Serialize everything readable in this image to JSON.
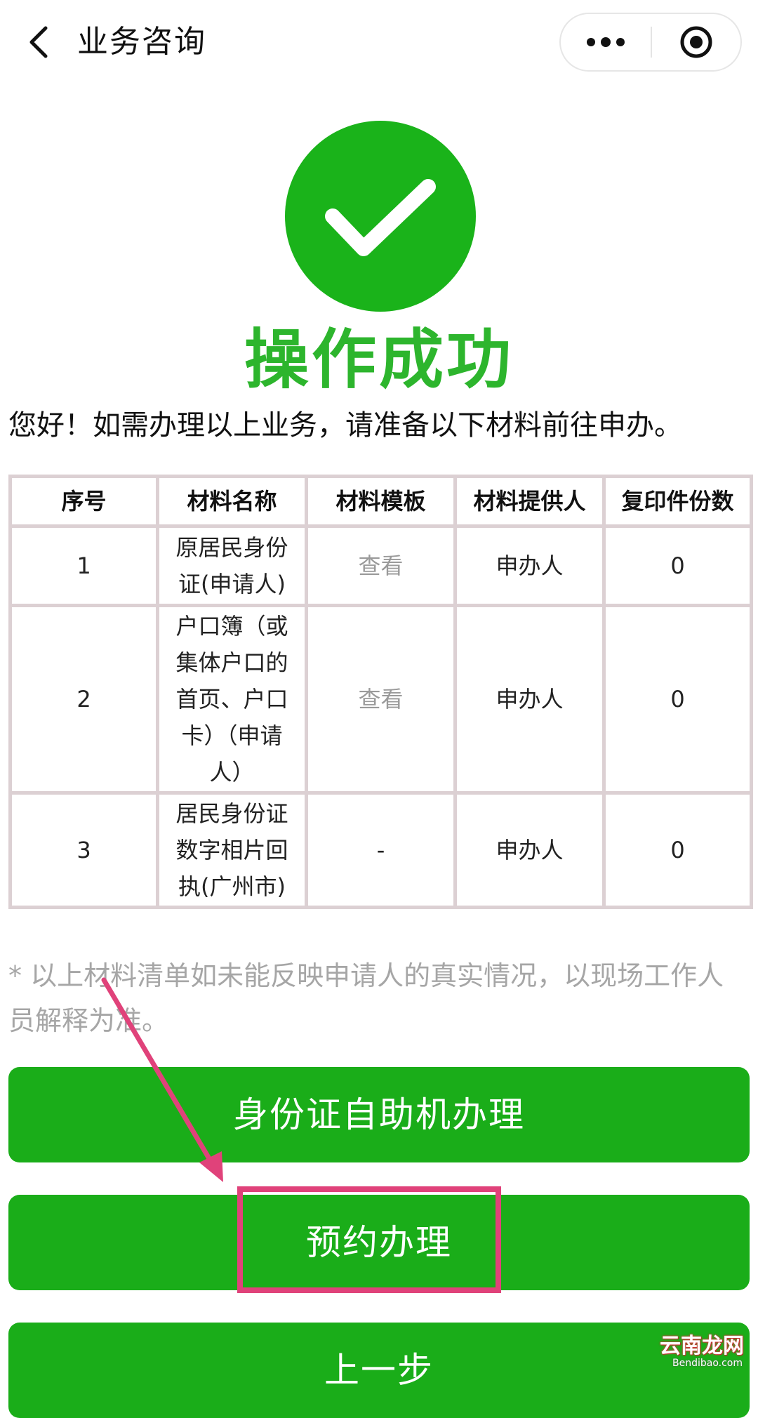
{
  "navbar": {
    "title": "业务咨询",
    "back_icon": "chevron-left-icon",
    "more_icon": "more-dots-icon",
    "close_icon": "target-close-icon"
  },
  "success": {
    "icon": "checkmark-circle-icon",
    "title": "操作成功",
    "color": "#2db52d"
  },
  "intro": "您好！如需办理以上业务，请准备以下材料前往申办。",
  "table": {
    "headers": [
      "序号",
      "材料名称",
      "材料模板",
      "材料提供人",
      "复印件份数"
    ],
    "rows": [
      {
        "no": "1",
        "name": "原居民身份证(申请人)",
        "template": "查看",
        "provider": "申办人",
        "copies": "0"
      },
      {
        "no": "2",
        "name": "户口簿（或集体户口的首页、户口卡）（申请人）",
        "template": "查看",
        "provider": "申办人",
        "copies": "0"
      },
      {
        "no": "3",
        "name": "居民身份证数字相片回执(广州市)",
        "template": "-",
        "provider": "申办人",
        "copies": "0"
      }
    ]
  },
  "note": "* 以上材料清单如未能反映申请人的真实情况，以现场工作人员解释为准。",
  "buttons": {
    "kiosk": "身份证自助机办理",
    "appointment": "预约办理",
    "back": "上一步"
  },
  "colors": {
    "button_green": "#1aad19",
    "annotation_pink": "#e0427a",
    "table_border": "#dcd0d3",
    "note_gray": "#a6a6a6"
  },
  "watermark": {
    "main": "云南龙网",
    "sub": "Bendibao.com"
  }
}
